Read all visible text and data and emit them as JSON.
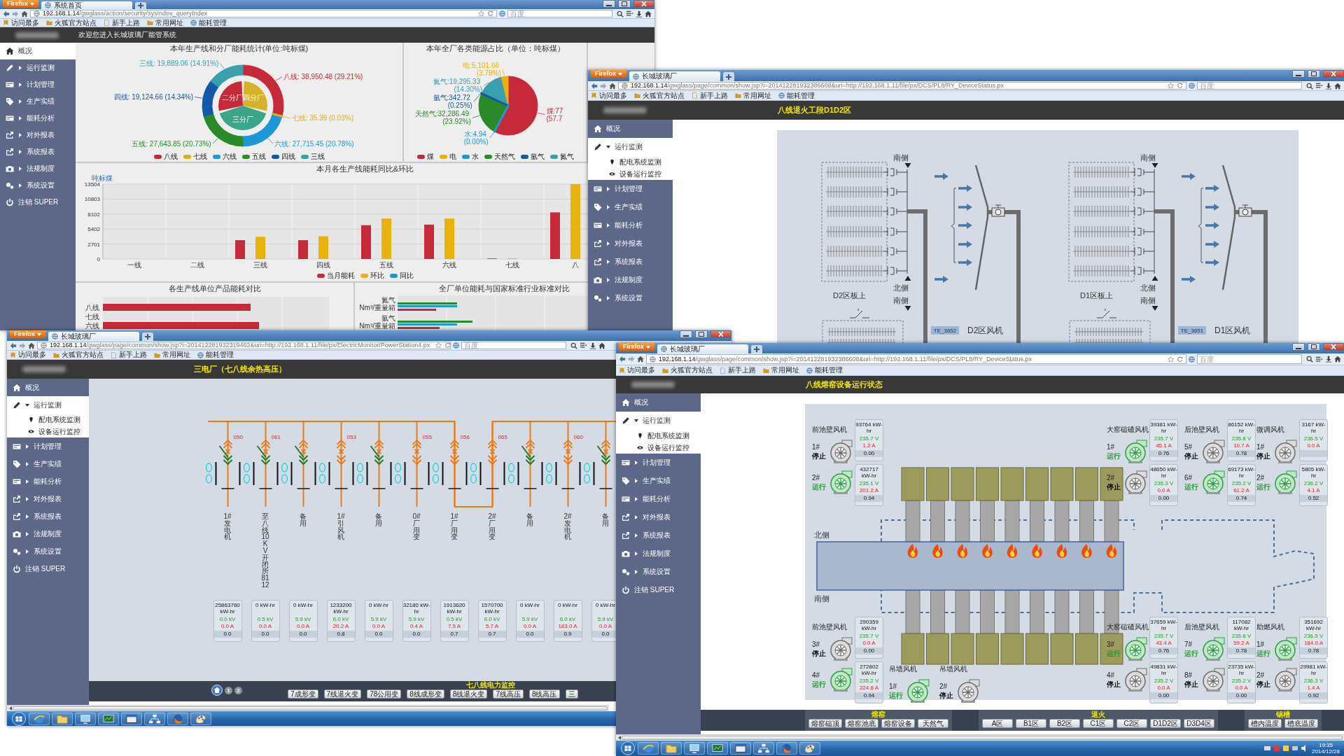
{
  "windows": [
    {
      "kind": "overview",
      "browser": {
        "menu_button": "Firefox",
        "tab": "系统首页",
        "url_host": "192.168.1.14",
        "url_path": "/gwglass/action/security/sysIndex_queryIndex",
        "search_placeholder": "百度",
        "bookmarks": [
          "访问最多",
          "火狐官方站点",
          "新手上路",
          "常用网址",
          "能耗管理"
        ]
      },
      "header": {
        "kind": "welcome",
        "text": "欢迎您进入长城玻璃厂能管系统"
      },
      "sidebar": {
        "items": [
          {
            "label": "概况",
            "selected": true
          },
          {
            "label": "运行监测",
            "selected": false,
            "expanded": false
          },
          {
            "label": "计划管理",
            "selected": false,
            "expanded": false
          },
          {
            "label": "生产实绩",
            "selected": false,
            "expanded": false
          },
          {
            "label": "能耗分析",
            "selected": false,
            "expanded": false
          },
          {
            "label": "对外报表",
            "selected": false,
            "expanded": false
          },
          {
            "label": "系统报表",
            "selected": false,
            "expanded": false
          },
          {
            "label": "法规制度",
            "selected": false,
            "expanded": false
          },
          {
            "label": "系统设置",
            "selected": false,
            "expanded": false
          },
          {
            "label": "注销 SUPER",
            "selected": false
          }
        ]
      },
      "content": {
        "donut": {
          "chart_data": {
            "type": "donut",
            "title": "本年生产线和分厂能耗统计(单位:吨标煤)",
            "series": [
              {
                "values": [
                  29.21,
                  0.03,
                  20.78,
                  20.73,
                  14.34,
                  14.91
                ],
                "colors": [
                  "#c62a3a",
                  "#d9b11c",
                  "#1d97d8",
                  "#2a8a2a",
                  "#1458a8",
                  "#3a9fad"
                ]
              },
              {
                "values": [
                  29.24,
                  41.51,
                  29.25
                ],
                "colors": [
                  "#d4b22a",
                  "#3aa58a",
                  "#c62a3a"
                ]
              }
            ],
            "value_labels": [
              "八线: 38,950.48 (29.21%)",
              "七线: 35.39 (0.03%)",
              "六线: 27,715.45 (20.78%)",
              "五线: 27,643.85 (20.73%)",
              "四线: 19,124.66 (14.34%)",
              "三线: 19,889.06 (14.91%)"
            ]
          },
          "legend": [
            {
              "label": "八线",
              "color": "#c62a3a"
            },
            {
              "label": "七线",
              "color": "#d9b11c"
            },
            {
              "label": "六线",
              "color": "#1d97d8"
            },
            {
              "label": "五线",
              "color": "#2a8a2a"
            },
            {
              "label": "四线",
              "color": "#1458a8"
            },
            {
              "label": "三线",
              "color": "#3a9fad"
            }
          ],
          "inner_ring": [
            {
              "label": "四分厂"
            },
            {
              "label": "三分厂"
            },
            {
              "label": "二分厂"
            }
          ]
        },
        "pie": {
          "chart_data": {
            "type": "pie",
            "title": "本年全厂各类能源占比（单位：吨标煤）",
            "series": [
              {
                "values": [
                  57.75,
                  0.004,
                  23.92,
                  0.25,
                  14.3,
                  3.78
                ],
                "colors": [
                  "#c62a3a",
                  "#1d97d8",
                  "#2a8a2a",
                  "#1458a8",
                  "#3a9fad",
                  "#e8b10c"
                ]
              }
            ],
            "value_labels": [
              "煤:77 (57.7",
              "水:4.94 (0.00%)",
              "天然气:32,286.49 (23.92%)",
              "氩气:342.72 (0.25%)",
              "氮气:19,295.33 (14.30%)",
              "电:5,101.66 (3.78%)"
            ]
          },
          "legend": [
            {
              "label": "煤",
              "color": "#c62a3a"
            },
            {
              "label": "电",
              "color": "#e8b10c"
            },
            {
              "label": "水",
              "color": "#1d97d8"
            },
            {
              "label": "天然气",
              "color": "#2a8a2a"
            },
            {
              "label": "氩气",
              "color": "#1458a8"
            },
            {
              "label": "氮气",
              "color": "#3a9fad"
            }
          ]
        },
        "bar": {
          "chart_data": {
            "type": "bar",
            "title": "本月各生产线能耗同比&环比",
            "ylabel": "吨标煤",
            "categories": [
              "一线",
              "二线",
              "三线",
              "四线",
              "五线",
              "六线",
              "七线",
              "八"
            ],
            "series": [
              {
                "name": "当月能耗",
                "color": "#c62a3a",
                "values": [
                  0,
                  0,
                  3400,
                  3400,
                  6100,
                  6200,
                  100,
                  8400
                ]
              },
              {
                "name": "环比",
                "color": "#e8b10c",
                "values": [
                  0,
                  0,
                  4000,
                  4100,
                  7300,
                  7300,
                  100,
                  13500
                ]
              },
              {
                "name": "同比",
                "color": "#1d97d8",
                "values": [
                  null,
                  null,
                  null,
                  null,
                  null,
                  null,
                  null,
                  null
                ]
              }
            ],
            "ylim": [
              0,
              13504
            ],
            "yticks": [
              0,
              2701,
              5402,
              8102,
              10803,
              13504
            ],
            "grid": true
          }
        },
        "unit_chart": {
          "title": "各生产线单位产品能耗对比",
          "rows": [
            "八线",
            "七线",
            "六线"
          ]
        },
        "standard_chart": {
          "title": "全厂单位能耗与国家标准行业标准对比",
          "rows": [
            {
              "lines": [
                "氮气",
                "Nm³/重量箱"
              ]
            },
            {
              "lines": [
                "氩气",
                "Nm³/重量箱"
              ]
            }
          ]
        }
      }
    },
    {
      "kind": "annealing",
      "browser": {
        "menu_button": "Firefox",
        "tab": "长城玻璃厂",
        "url_host": "192.168.1.14",
        "url_path": "/gwglass/page/common/show.jsp?i=201412281932386608&uri=http://192.168.1.11/file/px/DCS/PL8/RY_DeviceStatus.px",
        "search_placeholder": "百度",
        "bookmarks": [
          "访问最多",
          "火狐官方站点",
          "新手上路",
          "常用网址",
          "能耗管理"
        ]
      },
      "header": {
        "kind": "page-title",
        "text": "八线退火工段D1D2区"
      },
      "sidebar": {
        "items": [
          {
            "label": "概况",
            "selected": false
          },
          {
            "label": "运行监测",
            "selected": true,
            "expanded": true,
            "children": [
              "配电系统监测",
              "设备运行监控"
            ]
          },
          {
            "label": "计划管理",
            "selected": false,
            "expanded": false
          },
          {
            "label": "生产实绩",
            "selected": false,
            "expanded": false
          },
          {
            "label": "能耗分析",
            "selected": false,
            "expanded": false
          },
          {
            "label": "对外报表",
            "selected": false,
            "expanded": false
          },
          {
            "label": "系统报表",
            "selected": false,
            "expanded": false
          },
          {
            "label": "法规制度",
            "selected": false,
            "expanded": false
          },
          {
            "label": "系统设置",
            "selected": false,
            "expanded": false
          }
        ]
      },
      "content": {
        "sections": [
          {
            "side_labels": [
              "南侧",
              "北侧",
              "南侧"
            ],
            "heater_label": "D2区板上",
            "fan_label": "D2区风机",
            "sensor_tag": "TE_3652"
          },
          {
            "side_labels": [
              "南侧",
              "北侧",
              "南侧"
            ],
            "heater_label": "D1区板上",
            "fan_label": "D1区风机",
            "sensor_tag": "TE_3651"
          }
        ]
      }
    },
    {
      "kind": "power",
      "browser": {
        "menu_button": "Firefox",
        "tab": "长城玻璃厂",
        "url_host": "192.168.1.14",
        "url_path": "/gwglass/page/common/show.jsp?i=201412281932319462&uri=http://192.168.1.11/file/px/ElectricMonitor/PowerStation4.px",
        "search_placeholder": "百度",
        "bookmarks": [
          "访问最多",
          "火狐官方站点",
          "新手上路",
          "常用网址",
          "能耗管理"
        ]
      },
      "header": {
        "kind": "page-title",
        "text": "三电厂（七八线余热高压）"
      },
      "sidebar": {
        "items": [
          {
            "label": "概况",
            "selected": false
          },
          {
            "label": "运行监测",
            "selected": true,
            "expanded": true,
            "children": [
              "配电系统监测",
              "设备运行监控"
            ]
          },
          {
            "label": "计划管理",
            "selected": false,
            "expanded": false
          },
          {
            "label": "生产实绩",
            "selected": false,
            "expanded": false
          },
          {
            "label": "能耗分析",
            "selected": false,
            "expanded": false
          },
          {
            "label": "对外报表",
            "selected": false,
            "expanded": false
          },
          {
            "label": "系统报表",
            "selected": false,
            "expanded": false
          },
          {
            "label": "法规制度",
            "selected": false,
            "expanded": false
          },
          {
            "label": "系统设置",
            "selected": false,
            "expanded": false
          },
          {
            "label": "注销 SUPER",
            "selected": false
          }
        ]
      },
      "content": {
        "feeders": [
          {
            "code": "050",
            "name": "1#发电机",
            "closed": false,
            "meter": {
              "energy": "25863760 kW-hr",
              "voltage": "0.0 kV",
              "current": "0.0 A",
              "power_factor": "0.0"
            }
          },
          {
            "code": "061",
            "name": "至八线10KV开闭所8112",
            "closed": false,
            "meter": {
              "energy": "0 kW-hr",
              "voltage": "0.5 kV",
              "current": "0.0 A",
              "power_factor": "0.0"
            }
          },
          {
            "name": "备用",
            "closed": false,
            "meter": {
              "energy": "0 kW-hr",
              "voltage": "5.9 kV",
              "current": "0.0 A",
              "power_factor": "0.0"
            }
          },
          {
            "code": "053",
            "name": "1#引风机",
            "closed": true,
            "meter": {
              "energy": "1233200 kW-hr",
              "voltage": "6.0 kV",
              "current": "20.2 A",
              "power_factor": "0.8"
            }
          },
          {
            "name": "备用",
            "closed": false,
            "meter": {
              "energy": "0 kW-hr",
              "voltage": "5.9 kV",
              "current": "0.0 A",
              "power_factor": "0.0"
            }
          },
          {
            "code": "055",
            "name": "0#厂用变",
            "closed": true,
            "meter": {
              "energy": "32180 kW-hr",
              "voltage": "5.9 kV",
              "current": "0.4 A",
              "power_factor": "0.0"
            }
          },
          {
            "code": "056",
            "name": "1#厂用变",
            "closed": true,
            "meter": {
              "energy": "1913620 kW-hr",
              "voltage": "0.5 kV",
              "current": "7.5 A",
              "power_factor": "0.7"
            }
          },
          {
            "code": "065",
            "name": "2#厂用变",
            "closed": true,
            "meter": {
              "energy": "1570700 kW-hr",
              "voltage": "6.0 kV",
              "current": "5.7 A",
              "power_factor": "0.7"
            }
          },
          {
            "name": "备用",
            "closed": false,
            "meter": {
              "energy": "0 kW-hr",
              "voltage": "5.9 kV",
              "current": "0.0 A",
              "power_factor": "0.0"
            }
          },
          {
            "code": "060",
            "name": "2#发电机",
            "closed": true,
            "meter": {
              "energy": "0 kW-hr",
              "voltage": "6.0 kV",
              "current": "183.0 A",
              "power_factor": "0.9"
            }
          },
          {
            "name": "备用",
            "closed": false,
            "meter": {
              "energy": "0 kW-hr",
              "voltage": "5.9 kV",
              "current": "0.0 A",
              "power_factor": "0.0"
            }
          }
        ],
        "bottom_bar": {
          "pages": [
            "1",
            "2"
          ],
          "title": "七八线电力监控",
          "buttons": [
            "7成形变",
            "7线退火变",
            "78公用变",
            "8线成形变",
            "8线退火变",
            "7线高压",
            "8线高压",
            "三"
          ]
        }
      },
      "taskbar": {
        "kind": "plain"
      }
    },
    {
      "kind": "kiln",
      "browser": {
        "menu_button": "Firefox",
        "tab": "长城玻璃厂",
        "url_host": "192.168.1.14",
        "url_path": "/gwglass/page/common/show.jsp?i=201412281932386608&uri=http://192.168.1.11/file/px/DCS/PL8/RY_DeviceStatus.px",
        "search_placeholder": "百度",
        "bookmarks": [
          "访问最多",
          "火狐官方站点",
          "新手上路",
          "常用网址",
          "能耗管理"
        ]
      },
      "header": {
        "kind": "page-title",
        "text": "八线熔窑设备运行状态"
      },
      "sidebar": {
        "items": [
          {
            "label": "概况",
            "selected": false
          },
          {
            "label": "运行监测",
            "selected": true,
            "expanded": true,
            "children": [
              "配电系统监测",
              "设备运行监控"
            ]
          },
          {
            "label": "计划管理",
            "selected": false,
            "expanded": false
          },
          {
            "label": "生产实绩",
            "selected": false,
            "expanded": false
          },
          {
            "label": "能耗分析",
            "selected": false,
            "expanded": false
          },
          {
            "label": "对外报表",
            "selected": false,
            "expanded": false
          },
          {
            "label": "系统报表",
            "selected": false,
            "expanded": false
          },
          {
            "label": "法规制度",
            "selected": false,
            "expanded": false
          },
          {
            "label": "系统设置",
            "selected": false,
            "expanded": false
          },
          {
            "label": "注销 SUPER",
            "selected": false
          }
        ]
      },
      "content": {
        "north_label": "北侧",
        "south_label": "南侧",
        "fan_groups": [
          {
            "title": "前池壁风机",
            "fans": [
              {
                "label": "1#",
                "status": "停止",
                "running": false,
                "meter": {
                  "energy": "93764 kW-hr",
                  "voltage": "235.7 V",
                  "current": "1.2 A",
                  "power_factor": "0.00"
                }
              },
              {
                "label": "2#",
                "status": "运行",
                "running": true,
                "meter": {
                  "energy": "432717 kW-hr",
                  "voltage": "235.1 V",
                  "current": "201.2 A",
                  "power_factor": "0.94"
                }
              }
            ]
          },
          {
            "title": "大窑碹碴风机",
            "fans": [
              {
                "label": "1#",
                "status": "运行",
                "running": true,
                "meter": {
                  "energy": "39381 kW-hr",
                  "voltage": "235.7 V",
                  "current": "45.1 A",
                  "power_factor": "0.76"
                }
              },
              {
                "label": "2#",
                "status": "停止",
                "running": false,
                "meter": {
                  "energy": "48650 kW-hr",
                  "voltage": "235.3 V",
                  "current": "0.0 A",
                  "power_factor": "0.00"
                }
              }
            ]
          },
          {
            "title": "后池壁风机",
            "fans": [
              {
                "label": "5#",
                "status": "停止",
                "running": false,
                "meter": {
                  "energy": "86152 kW-hr",
                  "voltage": "235.8 V",
                  "current": "10.7 A",
                  "power_factor": "0.78"
                }
              },
              {
                "label": "6#",
                "status": "运行",
                "running": true,
                "meter": {
                  "energy": "69173 kW-hr",
                  "voltage": "235.2 V",
                  "current": "61.2 A",
                  "power_factor": "0.74"
                }
              }
            ]
          },
          {
            "title": "微调风机",
            "fans": [
              {
                "label": "1#",
                "status": "停止",
                "running": false,
                "meter": {
                  "energy": "3167 kW-hr",
                  "voltage": "236.5 V",
                  "current": "0.0 A"
                }
              },
              {
                "label": "2#",
                "status": "运行",
                "running": true,
                "meter": {
                  "energy": "5805 kW-hr",
                  "voltage": "236.2 V",
                  "current": "4.1 A",
                  "power_factor": "0.52"
                }
              }
            ]
          },
          {
            "title": "前池壁风机",
            "fans": [
              {
                "label": "3#",
                "status": "停止",
                "running": false,
                "meter": {
                  "energy": "290359 kW-hr",
                  "voltage": "235.7 V",
                  "current": "0.0 A",
                  "power_factor": "0.00"
                }
              },
              {
                "label": "4#",
                "status": "运行",
                "running": true,
                "meter": {
                  "energy": "272802 kW-hr",
                  "voltage": "235.2 V",
                  "current": "224.8 A",
                  "power_factor": "0.94"
                }
              }
            ]
          },
          {
            "title": "吊墙风机",
            "fans": [
              {
                "label": "1#",
                "status": "运行",
                "running": true
              }
            ]
          },
          {
            "title": "吊墙风机",
            "fans": [
              {
                "label": "2#",
                "status": "停止",
                "running": false
              }
            ]
          },
          {
            "title": "大窑碹碴风机",
            "fans": [
              {
                "label": "3#",
                "status": "运行",
                "running": true,
                "meter": {
                  "energy": "37659 kW-hr",
                  "voltage": "235.7 V",
                  "current": "43.4 A",
                  "power_factor": "0.76"
                }
              },
              {
                "label": "4#",
                "status": "停止",
                "running": false,
                "meter": {
                  "energy": "49831 kW-hr",
                  "voltage": "235.2 V",
                  "current": "0.0 A",
                  "power_factor": "0.00"
                }
              }
            ]
          },
          {
            "title": "后池壁风机",
            "fans": [
              {
                "label": "7#",
                "status": "运行",
                "running": true,
                "meter": {
                  "energy": "117082 kW-hr",
                  "voltage": "235.8 V",
                  "current": "59.2 A",
                  "power_factor": "0.78"
                }
              },
              {
                "label": "8#",
                "status": "停止",
                "running": false,
                "meter": {
                  "energy": "23735 kW-hr",
                  "voltage": "235.2 V",
                  "current": "0.0 A",
                  "power_factor": "0.00"
                }
              }
            ]
          },
          {
            "title": "助燃风机",
            "fans": [
              {
                "label": "1#",
                "status": "运行",
                "running": true,
                "meter": {
                  "energy": "351692 kW-hr",
                  "voltage": "236.5 V",
                  "current": "184.0 A",
                  "power_factor": "0.78"
                }
              },
              {
                "label": "2#",
                "status": "停止",
                "running": false,
                "meter": {
                  "energy": "29981 kW-hr",
                  "voltage": "236.3 V",
                  "current": "1.4 A",
                  "power_factor": "0.92"
                }
              }
            ]
          }
        ],
        "bottom_bar": {
          "groups": [
            {
              "title": "熔窑",
              "buttons": [
                "熔窑碹顶",
                "熔窑池底",
                "熔窑设备",
                "天然气"
              ]
            },
            {
              "title": "退火",
              "buttons": [
                "A区",
                "B1区",
                "B2区",
                "C1区",
                "C2区",
                "D1D2区",
                "D3D4区"
              ]
            },
            {
              "title": "锡槽",
              "buttons": [
                "槽内温度",
                "槽底温度"
              ]
            }
          ]
        }
      },
      "taskbar": {
        "kind": "clock",
        "time": "19:35",
        "date": "2014/12/28"
      }
    }
  ]
}
